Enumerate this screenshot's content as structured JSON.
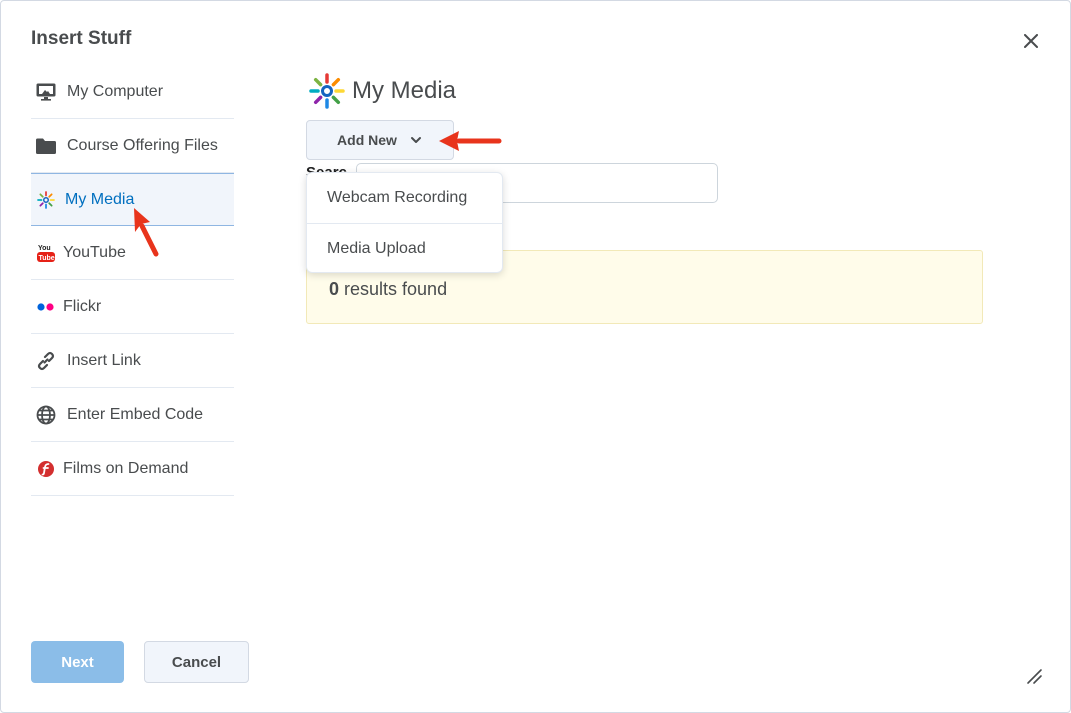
{
  "dialog": {
    "title": "Insert Stuff",
    "close_icon": "close-icon"
  },
  "sidebar": {
    "items": [
      {
        "label": "My Computer",
        "icon": "monitor-icon"
      },
      {
        "label": "Course Offering Files",
        "icon": "folder-icon"
      },
      {
        "label": "My Media",
        "icon": "my-media-icon",
        "active": true
      },
      {
        "label": "YouTube",
        "icon": "youtube-icon"
      },
      {
        "label": "Flickr",
        "icon": "flickr-icon"
      },
      {
        "label": "Insert Link",
        "icon": "link-icon"
      },
      {
        "label": "Enter Embed Code",
        "icon": "globe-icon"
      },
      {
        "label": "Films on Demand",
        "icon": "films-on-demand-icon"
      }
    ]
  },
  "main": {
    "title": "My Media",
    "add_new_label": "Add New",
    "search_label": "Searc",
    "search_value": "",
    "dropdown": {
      "items": [
        "Webcam Recording",
        "Media Upload"
      ]
    },
    "results_count": "0",
    "results_text": " results found"
  },
  "footer": {
    "next_label": "Next",
    "cancel_label": "Cancel"
  },
  "colors": {
    "accent": "#006fbf",
    "next_button": "#8bbde8",
    "results_bg": "#fffcea",
    "annotation_arrow": "#e8341c"
  }
}
